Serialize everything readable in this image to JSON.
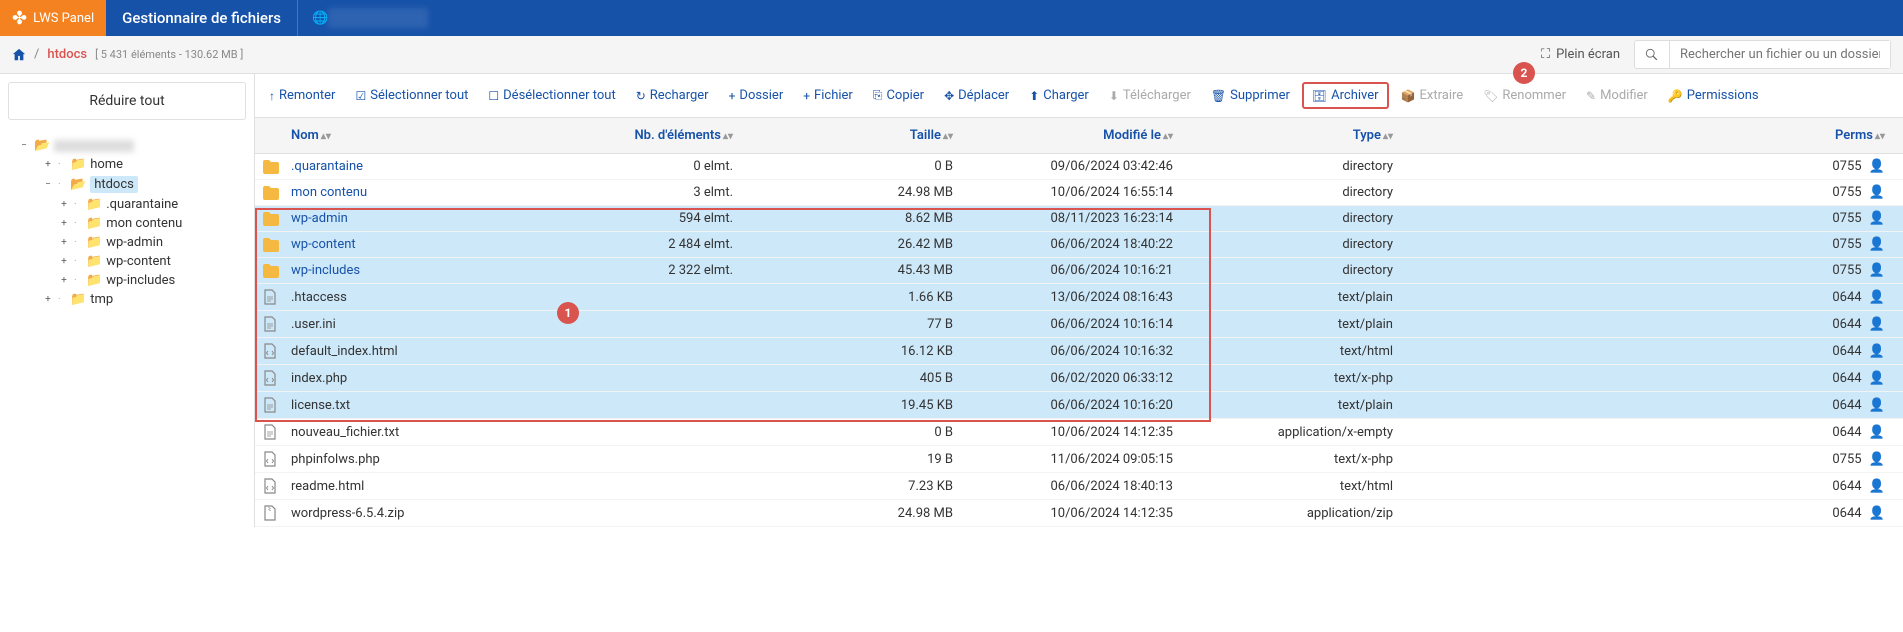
{
  "header": {
    "logo_text": "LWS Panel",
    "title": "Gestionnaire de fichiers"
  },
  "breadcrumb": {
    "current": "htdocs",
    "info": "[ 5 431 éléments - 130.62 MB ]",
    "fullscreen": "Plein écran",
    "search_placeholder": "Rechercher un fichier ou un dossier"
  },
  "sidebar": {
    "reduce_all": "Réduire tout",
    "nodes": {
      "home": "home",
      "htdocs": "htdocs",
      "quarantaine": ".quarantaine",
      "mon_contenu": "mon contenu",
      "wp_admin": "wp-admin",
      "wp_content": "wp-content",
      "wp_includes": "wp-includes",
      "tmp": "tmp"
    }
  },
  "toolbar": {
    "remonter": "Remonter",
    "select_all": "Sélectionner tout",
    "deselect_all": "Désélectionner tout",
    "recharger": "Recharger",
    "dossier": "Dossier",
    "fichier": "Fichier",
    "copier": "Copier",
    "deplacer": "Déplacer",
    "charger": "Charger",
    "telecharger": "Télécharger",
    "supprimer": "Supprimer",
    "archiver": "Archiver",
    "extraire": "Extraire",
    "renommer": "Renommer",
    "modifier": "Modifier",
    "permissions": "Permissions"
  },
  "columns": {
    "nom": "Nom",
    "elements": "Nb. d'éléments",
    "taille": "Taille",
    "modifie": "Modifié le",
    "type": "Type",
    "perms": "Perms"
  },
  "rows": [
    {
      "name": ".quarantaine",
      "icon": "folder",
      "link": true,
      "elmt": "0 elmt.",
      "size": "0 B",
      "mod": "09/06/2024 03:42:46",
      "type": "directory",
      "perms": "0755",
      "selected": false
    },
    {
      "name": "mon contenu",
      "icon": "folder",
      "link": true,
      "elmt": "3 elmt.",
      "size": "24.98 MB",
      "mod": "10/06/2024 16:55:14",
      "type": "directory",
      "perms": "0755",
      "selected": false
    },
    {
      "name": "wp-admin",
      "icon": "folder",
      "link": true,
      "elmt": "594 elmt.",
      "size": "8.62 MB",
      "mod": "08/11/2023 16:23:14",
      "type": "directory",
      "perms": "0755",
      "selected": true
    },
    {
      "name": "wp-content",
      "icon": "folder",
      "link": true,
      "elmt": "2 484 elmt.",
      "size": "26.42 MB",
      "mod": "06/06/2024 18:40:22",
      "type": "directory",
      "perms": "0755",
      "selected": true
    },
    {
      "name": "wp-includes",
      "icon": "folder",
      "link": true,
      "elmt": "2 322 elmt.",
      "size": "45.43 MB",
      "mod": "06/06/2024 10:16:21",
      "type": "directory",
      "perms": "0755",
      "selected": true
    },
    {
      "name": ".htaccess",
      "icon": "file",
      "link": false,
      "elmt": "",
      "size": "1.66 KB",
      "mod": "13/06/2024 08:16:43",
      "type": "text/plain",
      "perms": "0644",
      "selected": true
    },
    {
      "name": ".user.ini",
      "icon": "file",
      "link": false,
      "elmt": "",
      "size": "77 B",
      "mod": "06/06/2024 10:16:14",
      "type": "text/plain",
      "perms": "0644",
      "selected": true
    },
    {
      "name": "default_index.html",
      "icon": "file-code",
      "link": false,
      "elmt": "",
      "size": "16.12 KB",
      "mod": "06/06/2024 10:16:32",
      "type": "text/html",
      "perms": "0644",
      "selected": true
    },
    {
      "name": "index.php",
      "icon": "file-code",
      "link": false,
      "elmt": "",
      "size": "405 B",
      "mod": "06/02/2020 06:33:12",
      "type": "text/x-php",
      "perms": "0644",
      "selected": true
    },
    {
      "name": "license.txt",
      "icon": "file",
      "link": false,
      "elmt": "",
      "size": "19.45 KB",
      "mod": "06/06/2024 10:16:20",
      "type": "text/plain",
      "perms": "0644",
      "selected": true
    },
    {
      "name": "nouveau_fichier.txt",
      "icon": "file",
      "link": false,
      "elmt": "",
      "size": "0 B",
      "mod": "10/06/2024 14:12:35",
      "type": "application/x-empty",
      "perms": "0644",
      "selected": false
    },
    {
      "name": "phpinfolws.php",
      "icon": "file-code",
      "link": false,
      "elmt": "",
      "size": "19 B",
      "mod": "11/06/2024 09:05:15",
      "type": "text/x-php",
      "perms": "0755",
      "selected": false
    },
    {
      "name": "readme.html",
      "icon": "file-code",
      "link": false,
      "elmt": "",
      "size": "7.23 KB",
      "mod": "06/06/2024 18:40:13",
      "type": "text/html",
      "perms": "0644",
      "selected": false
    },
    {
      "name": "wordpress-6.5.4.zip",
      "icon": "file-zip",
      "link": false,
      "elmt": "",
      "size": "24.98 MB",
      "mod": "10/06/2024 14:12:35",
      "type": "application/zip",
      "perms": "0644",
      "selected": false
    }
  ],
  "badges": {
    "b1": "1",
    "b2": "2"
  }
}
